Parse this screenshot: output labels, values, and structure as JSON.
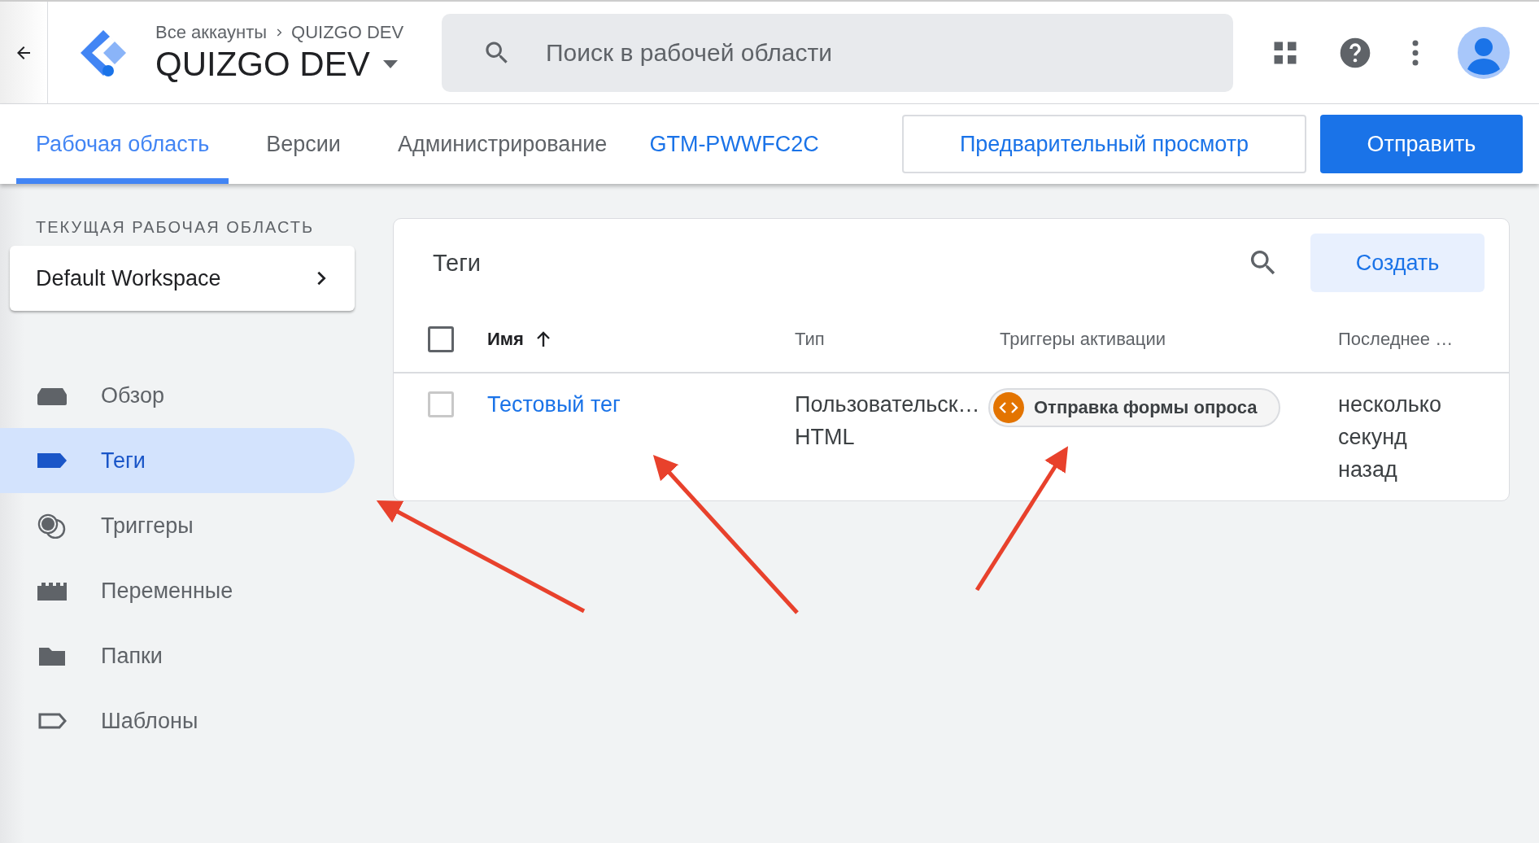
{
  "header": {
    "breadcrumb": {
      "parent": "Все аккаунты",
      "current": "QUIZGO DEV"
    },
    "container_name": "QUIZGO DEV",
    "search": {
      "placeholder": "Поиск в рабочей области"
    }
  },
  "tabs": [
    {
      "label": "Рабочая область",
      "selected": true
    },
    {
      "label": "Версии",
      "selected": false
    },
    {
      "label": "Администрирование",
      "selected": false
    }
  ],
  "container_id": "GTM-PWWFC2C",
  "buttons": {
    "preview": "Предварительный просмотр",
    "submit": "Отправить"
  },
  "sidebar": {
    "section_label": "ТЕКУЩАЯ РАБОЧАЯ ОБЛАСТЬ",
    "workspace": "Default Workspace",
    "items": [
      {
        "label": "Обзор",
        "kind": "overview",
        "selected": false
      },
      {
        "label": "Теги",
        "kind": "tags",
        "selected": true
      },
      {
        "label": "Триггеры",
        "kind": "triggers",
        "selected": false
      },
      {
        "label": "Переменные",
        "kind": "variables",
        "selected": false
      },
      {
        "label": "Папки",
        "kind": "folders",
        "selected": false
      },
      {
        "label": "Шаблоны",
        "kind": "templates",
        "selected": false
      }
    ]
  },
  "tags_card": {
    "title": "Теги",
    "create_button": "Создать",
    "header_checked": false,
    "columns": [
      "Имя",
      "Тип",
      "Триггеры активации",
      "Последнее …"
    ],
    "rows": [
      {
        "checked": false,
        "name": "Тестовый тег",
        "type": [
          "Пользовательск…",
          "HTML"
        ],
        "trigger": {
          "label": "Отправка формы опроса",
          "color": "#e37400"
        },
        "last_edited": [
          "несколько",
          "секунд",
          "назад"
        ]
      }
    ]
  }
}
